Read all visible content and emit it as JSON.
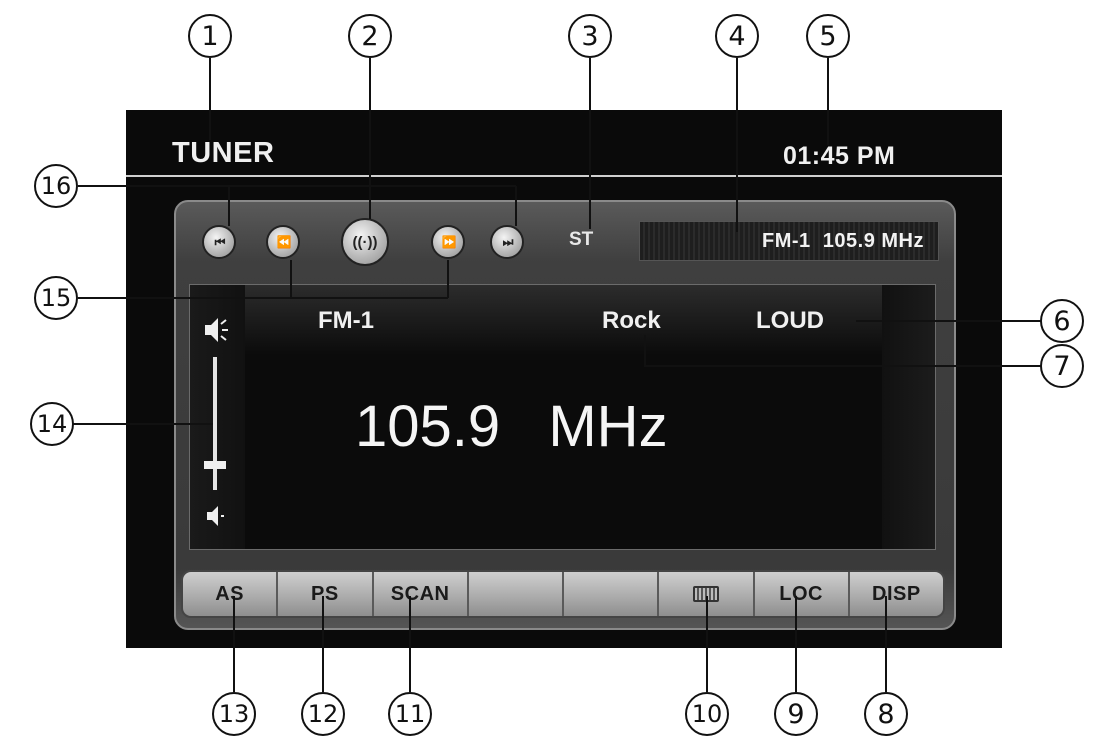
{
  "header": {
    "title": "TUNER",
    "clock": "01:45 PM"
  },
  "status": {
    "stereo": "ST",
    "band_frequency": "FM-1  105.9 MHz"
  },
  "screen": {
    "band": "FM-1",
    "genre": "Rock",
    "loudness": "LOUD",
    "frequency": "105.9  MHz"
  },
  "controls": {
    "seek_prev": "⏮",
    "tune_down": "⏪",
    "radio": "((·))",
    "tune_up": "⏩",
    "seek_next": "⏭"
  },
  "softkeys": [
    "AS",
    "PS",
    "SCAN",
    "",
    "",
    "",
    "LOC",
    "DISP"
  ],
  "icons": {
    "volume_high": "speaker-high-icon",
    "volume_low": "speaker-low-icon",
    "keyboard": "keyboard-icon"
  },
  "callouts": [
    "1",
    "2",
    "3",
    "4",
    "5",
    "6",
    "7",
    "8",
    "9",
    "10",
    "11",
    "12",
    "13",
    "14",
    "15",
    "16"
  ],
  "colors": {
    "device": "#0a0a0a",
    "panel": "#3f3f3f",
    "button": "#b9b9b9",
    "text": "#f0f0f0"
  }
}
